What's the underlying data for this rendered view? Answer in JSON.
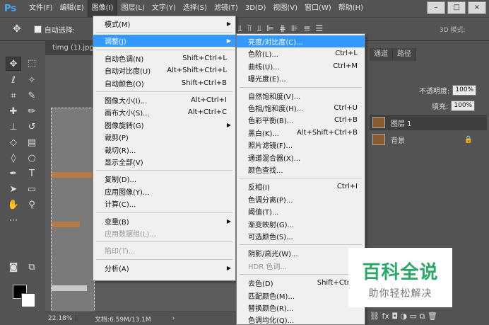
{
  "menubar": {
    "logo": "Ps",
    "items": [
      "文件(F)",
      "编辑(E)",
      "图像(I)",
      "图层(L)",
      "文字(Y)",
      "选择(S)",
      "滤镜(T)",
      "3D(D)",
      "视图(V)",
      "窗口(W)",
      "帮助(H)"
    ],
    "active_index": 2,
    "window_buttons": [
      "–",
      "□",
      "×"
    ]
  },
  "optbar": {
    "move_icon": "move-icon",
    "auto_select_label": "自动选择:",
    "mode_3d": "3D 模式:"
  },
  "document": {
    "tab_title": "timg (1).jpg",
    "zoom": "22.18%",
    "doc_info": "文档:6.59M/13.1M",
    "nav_arrow": "›"
  },
  "panels": {
    "tabs": [
      "通道",
      "路径"
    ],
    "opacity_label": "不透明度:",
    "opacity_value": "100%",
    "fill_label": "填充:",
    "fill_value": "100%",
    "layers": [
      {
        "name": "图层 1",
        "active": true
      },
      {
        "name": "背景",
        "active": false,
        "locked": true
      }
    ],
    "bottom_icons": "⛓ fx ◘ ◑ ▭ ⧉ 🗑"
  },
  "image_menu": {
    "items": [
      {
        "label": "模式(M)",
        "shortcut": "",
        "submenu": true
      },
      {
        "sep": true
      },
      {
        "label": "调整(J)",
        "shortcut": "",
        "submenu": true,
        "highlight": true
      },
      {
        "sep": true
      },
      {
        "label": "自动色调(N)",
        "shortcut": "Shift+Ctrl+L"
      },
      {
        "label": "自动对比度(U)",
        "shortcut": "Alt+Shift+Ctrl+L"
      },
      {
        "label": "自动颜色(O)",
        "shortcut": "Shift+Ctrl+B"
      },
      {
        "sep": true
      },
      {
        "label": "图像大小(I)...",
        "shortcut": "Alt+Ctrl+I"
      },
      {
        "label": "画布大小(S)...",
        "shortcut": "Alt+Ctrl+C"
      },
      {
        "label": "图像旋转(G)",
        "shortcut": "",
        "submenu": true
      },
      {
        "label": "裁剪(P)",
        "shortcut": ""
      },
      {
        "label": "裁切(R)...",
        "shortcut": ""
      },
      {
        "label": "显示全部(V)",
        "shortcut": ""
      },
      {
        "sep": true
      },
      {
        "label": "复制(D)...",
        "shortcut": ""
      },
      {
        "label": "应用图像(Y)...",
        "shortcut": ""
      },
      {
        "label": "计算(C)...",
        "shortcut": ""
      },
      {
        "sep": true
      },
      {
        "label": "变量(B)",
        "shortcut": "",
        "submenu": true
      },
      {
        "label": "应用数据组(L)...",
        "shortcut": "",
        "disabled": true
      },
      {
        "sep": true
      },
      {
        "label": "陷印(T)...",
        "shortcut": "",
        "disabled": true
      },
      {
        "sep": true
      },
      {
        "label": "分析(A)",
        "shortcut": "",
        "submenu": true
      }
    ]
  },
  "adjust_menu": {
    "items": [
      {
        "label": "亮度/对比度(C)...",
        "shortcut": "",
        "highlight": true
      },
      {
        "label": "色阶(L)...",
        "shortcut": "Ctrl+L"
      },
      {
        "label": "曲线(U)...",
        "shortcut": "Ctrl+M"
      },
      {
        "label": "曝光度(E)...",
        "shortcut": ""
      },
      {
        "sep": true
      },
      {
        "label": "自然饱和度(V)...",
        "shortcut": ""
      },
      {
        "label": "色相/饱和度(H)...",
        "shortcut": "Ctrl+U"
      },
      {
        "label": "色彩平衡(B)...",
        "shortcut": "Ctrl+B"
      },
      {
        "label": "黑白(K)...",
        "shortcut": "Alt+Shift+Ctrl+B"
      },
      {
        "label": "照片滤镜(F)...",
        "shortcut": ""
      },
      {
        "label": "通道混合器(X)...",
        "shortcut": ""
      },
      {
        "label": "颜色查找...",
        "shortcut": ""
      },
      {
        "sep": true
      },
      {
        "label": "反相(I)",
        "shortcut": "Ctrl+I"
      },
      {
        "label": "色调分离(P)...",
        "shortcut": ""
      },
      {
        "label": "阈值(T)...",
        "shortcut": ""
      },
      {
        "label": "渐变映射(G)...",
        "shortcut": ""
      },
      {
        "label": "可选颜色(S)...",
        "shortcut": ""
      },
      {
        "sep": true
      },
      {
        "label": "阴影/高光(W)...",
        "shortcut": ""
      },
      {
        "label": "HDR 色调...",
        "shortcut": "",
        "disabled": true
      },
      {
        "sep": true
      },
      {
        "label": "去色(D)",
        "shortcut": "Shift+Ctrl+"
      },
      {
        "label": "匹配颜色(M)...",
        "shortcut": ""
      },
      {
        "label": "替换颜色(R)...",
        "shortcut": ""
      },
      {
        "label": "色调均化(Q)...",
        "shortcut": ""
      }
    ]
  },
  "watermark": {
    "title": "百科全说",
    "subtitle": "助你轻松解决"
  },
  "colors": {
    "menu_highlight": "#3399ff",
    "watermark_green": "#2aa868",
    "ui_bg": "#535353"
  }
}
